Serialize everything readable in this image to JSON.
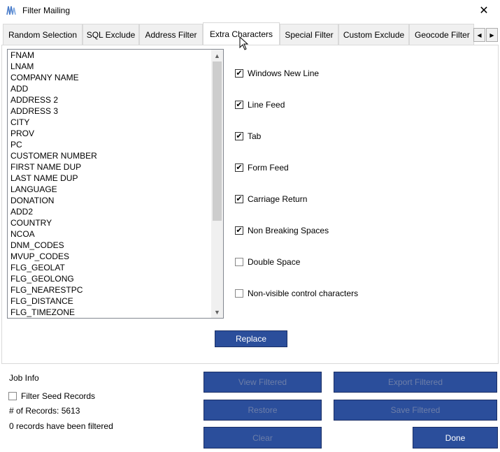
{
  "window": {
    "title": "Filter Mailing",
    "close_glyph": "✕"
  },
  "tabs": [
    {
      "label": "Random Selection",
      "active": false
    },
    {
      "label": "SQL Exclude",
      "active": false
    },
    {
      "label": "Address Filter",
      "active": false
    },
    {
      "label": "Extra Characters",
      "active": true
    },
    {
      "label": "Special Filter",
      "active": false
    },
    {
      "label": "Custom Exclude",
      "active": false
    },
    {
      "label": "Geocode Filter",
      "active": false
    }
  ],
  "tab_scroll": {
    "left": "◀",
    "right": "▶"
  },
  "fields_list": [
    "FNAM",
    "LNAM",
    "COMPANY NAME",
    "ADD",
    "ADDRESS 2",
    "ADDRESS 3",
    "CITY",
    "PROV",
    "PC",
    "CUSTOMER NUMBER",
    "FIRST NAME DUP",
    "LAST NAME DUP",
    "LANGUAGE",
    "DONATION",
    "ADD2",
    "COUNTRY",
    "NCOA",
    "DNM_CODES",
    "MVUP_CODES",
    "FLG_GEOLAT",
    "FLG_GEOLONG",
    "FLG_NEARESTPC",
    "FLG_DISTANCE",
    "FLG_TIMEZONE"
  ],
  "list_scroll": {
    "up": "▲",
    "down": "▼"
  },
  "options": [
    {
      "label": "Windows New Line",
      "checked": true
    },
    {
      "label": "Line Feed",
      "checked": true
    },
    {
      "label": "Tab",
      "checked": true
    },
    {
      "label": "Form Feed",
      "checked": true
    },
    {
      "label": "Carriage Return",
      "checked": true
    },
    {
      "label": "Non Breaking Spaces",
      "checked": true
    },
    {
      "label": "Double Space",
      "checked": false
    },
    {
      "label": "Non-visible control characters",
      "checked": false
    }
  ],
  "check_glyph": "✔",
  "replace_label": "Replace",
  "job_info": {
    "heading": "Job Info",
    "filter_seed_label": "Filter Seed Records",
    "filter_seed_checked": false,
    "records_count": "# of Records: 5613",
    "filtered_status": "0 records have been filtered"
  },
  "buttons": {
    "view_filtered": "View Filtered",
    "export_filtered": "Export Filtered",
    "restore": "Restore",
    "save_filtered": "Save Filtered",
    "clear": "Clear",
    "done": "Done"
  },
  "colors": {
    "button_bg": "#2b4e9b",
    "button_disabled_text": "#6d7ea8"
  }
}
